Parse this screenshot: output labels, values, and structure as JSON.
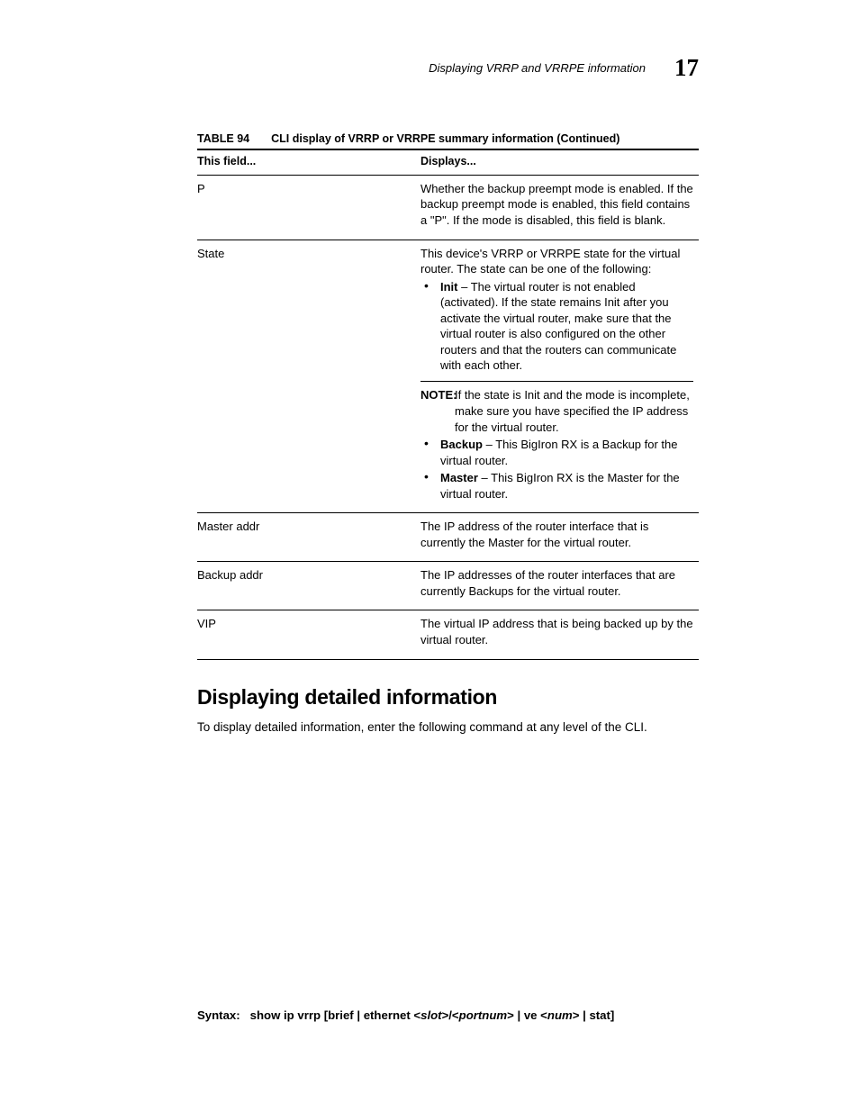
{
  "header": {
    "running_title": "Displaying VRRP and VRRPE information",
    "chapter_number": "17"
  },
  "table": {
    "label": "TABLE 94",
    "title": "CLI display of VRRP or VRRPE summary information  (Continued)",
    "col_field": "This field...",
    "col_desc": "Displays...",
    "rows": {
      "p": {
        "field": "P",
        "desc": "Whether the backup preempt mode is enabled.  If the backup preempt mode is enabled, this field contains a \"P\".  If the mode is disabled, this field is blank."
      },
      "state": {
        "field": "State",
        "intro": "This device's VRRP or VRRPE state for the virtual router. The state can be one of the following:",
        "init_label": "Init",
        "init_text": " – The virtual router is not enabled (activated).  If the state remains Init after you activate the virtual router, make sure that the virtual router is also configured on the other routers and that the routers can communicate with each other.",
        "note_label": "NOTE:",
        "note_text": "If the state is Init and the mode is incomplete, make sure you have specified the IP address for the virtual router.",
        "backup_label": "Backup",
        "backup_text": " – This BigIron RX is a Backup for the virtual router.",
        "master_label": "Master",
        "master_text": " – This BigIron RX is the Master for the virtual router."
      },
      "master_addr": {
        "field": "Master addr",
        "desc": "The IP address of the router interface that is currently the Master for the virtual router."
      },
      "backup_addr": {
        "field": "Backup addr",
        "desc": "The IP addresses of the router interfaces that are currently Backups for the virtual router."
      },
      "vip": {
        "field": "VIP",
        "desc": "The virtual IP address that is being backed up by the virtual router."
      }
    }
  },
  "section": {
    "heading": "Displaying detailed information",
    "body": "To display detailed information, enter the following command at any level of the CLI."
  },
  "syntax": {
    "label": "Syntax:",
    "cmd_pre": "show ip vrrp [brief | ethernet <",
    "var_slot": "slot",
    "mid1": ">/<",
    "var_port": "portnum",
    "mid2": "> | ve <",
    "var_num": "num",
    "tail": "> | stat]"
  }
}
